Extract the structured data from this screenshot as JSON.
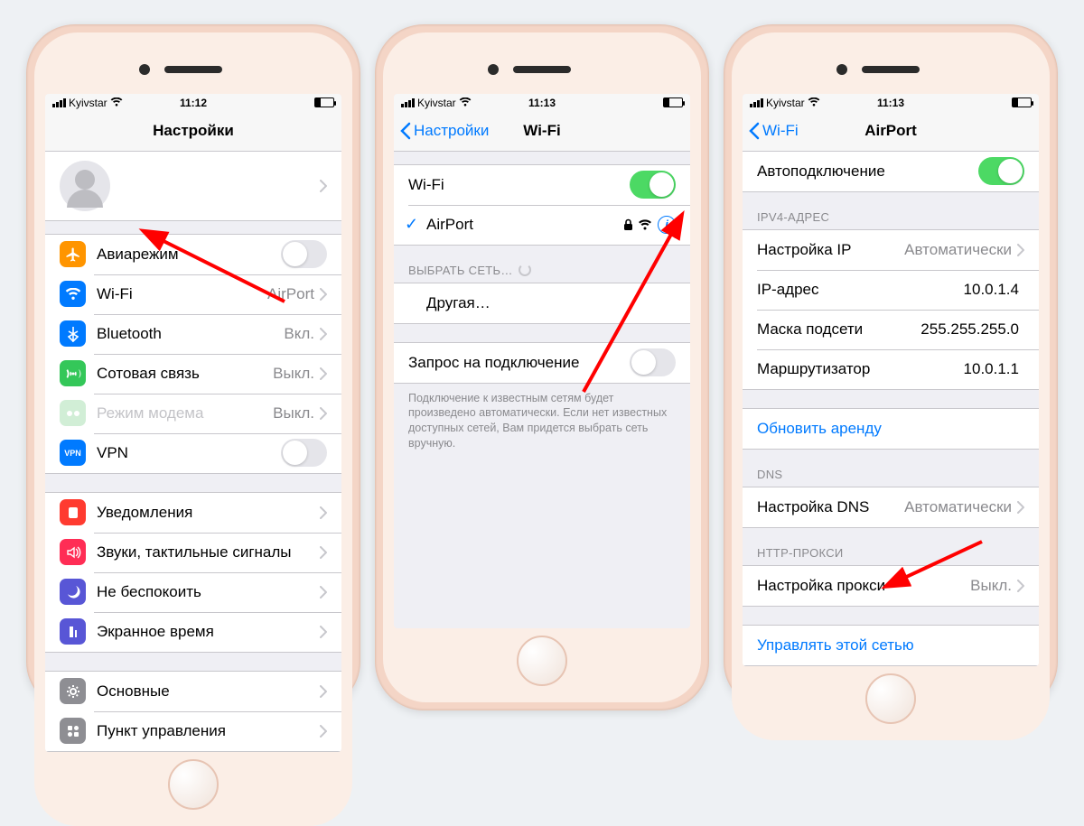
{
  "screen1": {
    "status": {
      "carrier": "Kyivstar",
      "time": "11:12"
    },
    "title": "Настройки",
    "rows": {
      "airplane": "Авиарежим",
      "wifi": "Wi-Fi",
      "wifi_val": "AirPort",
      "bluetooth": "Bluetooth",
      "bluetooth_val": "Вкл.",
      "cellular": "Сотовая связь",
      "cellular_val": "Выкл.",
      "hotspot": "Режим модема",
      "hotspot_val": "Выкл.",
      "vpn": "VPN",
      "notifications": "Уведомления",
      "sounds": "Звуки, тактильные сигналы",
      "dnd": "Не беспокоить",
      "screentime": "Экранное время",
      "general": "Основные",
      "control": "Пункт управления"
    }
  },
  "screen2": {
    "status": {
      "carrier": "Kyivstar",
      "time": "11:13"
    },
    "back": "Настройки",
    "title": "Wi-Fi",
    "wifi_label": "Wi-Fi",
    "network": "AirPort",
    "choose_header": "ВЫБРАТЬ СЕТЬ…",
    "other": "Другая…",
    "ask": "Запрос на подключение",
    "footer": "Подключение к известным сетям будет произведено автоматически. Если нет известных доступных сетей, Вам придется выбрать сеть вручную."
  },
  "screen3": {
    "status": {
      "carrier": "Kyivstar",
      "time": "11:13"
    },
    "back": "Wi-Fi",
    "title": "AirPort",
    "autojoin": "Автоподключение",
    "ipv4_header": "IPV4-АДРЕС",
    "ip_config": "Настройка IP",
    "ip_config_val": "Автоматически",
    "ip_addr": "IP-адрес",
    "ip_addr_val": "10.0.1.4",
    "subnet": "Маска подсети",
    "subnet_val": "255.255.255.0",
    "router": "Маршрутизатор",
    "router_val": "10.0.1.1",
    "renew": "Обновить аренду",
    "dns_header": "DNS",
    "dns_config": "Настройка DNS",
    "dns_config_val": "Автоматически",
    "proxy_header": "HTTP-ПРОКСИ",
    "proxy_config": "Настройка прокси",
    "proxy_config_val": "Выкл.",
    "manage": "Управлять этой сетью"
  }
}
